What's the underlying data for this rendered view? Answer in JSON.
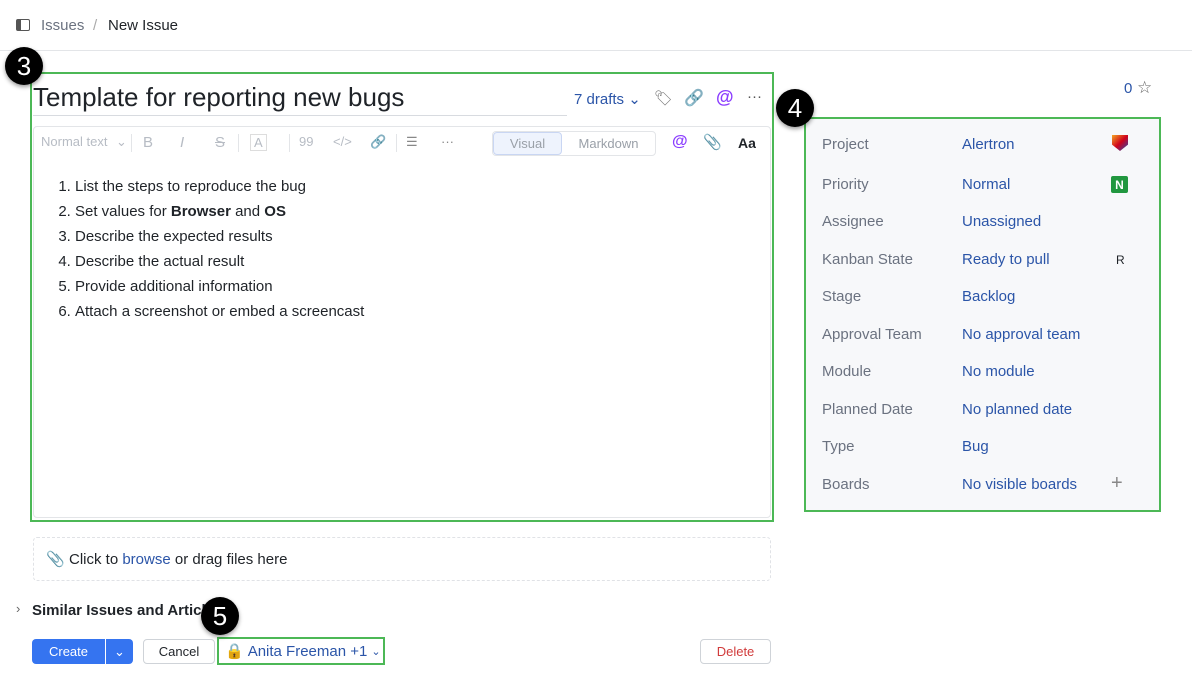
{
  "breadcrumb": {
    "root": "Issues",
    "sep": "/",
    "current": "New Issue"
  },
  "title": "Template for reporting new bugs",
  "drafts": "7 drafts",
  "toolbar": {
    "format": "Normal text",
    "bold": "B",
    "italic": "I",
    "strike": "S",
    "color": "A",
    "quote": "99",
    "code": "</>",
    "list": "☰",
    "more": "···",
    "visual": "Visual",
    "markdown": "Markdown",
    "font": "Aa"
  },
  "steps": [
    "List the steps to reproduce the bug",
    "Set values for ",
    "Describe the expected results",
    "Describe the actual result",
    "Provide additional information",
    "Attach a screenshot or embed a screencast"
  ],
  "step2": {
    "b1": "Browser",
    "mid": " and ",
    "b2": "OS"
  },
  "attach": {
    "pre": "Click to ",
    "link": "browse",
    "post": " or drag files here"
  },
  "similar": "Similar Issues and Articles",
  "buttons": {
    "create": "Create",
    "cancel": "Cancel",
    "visibility": "Anita Freeman +1",
    "delete": "Delete"
  },
  "votes": "0",
  "fields": [
    {
      "label": "Project",
      "value": "Alertron"
    },
    {
      "label": "Priority",
      "value": "Normal",
      "badge": "N"
    },
    {
      "label": "Assignee",
      "value": "Unassigned"
    },
    {
      "label": "Kanban State",
      "value": "Ready to pull",
      "badge": "R"
    },
    {
      "label": "Stage",
      "value": "Backlog"
    },
    {
      "label": "Approval Team",
      "value": "No approval team"
    },
    {
      "label": "Module",
      "value": "No module"
    },
    {
      "label": "Planned Date",
      "value": "No planned date"
    },
    {
      "label": "Type",
      "value": "Bug"
    },
    {
      "label": "Boards",
      "value": "No visible boards"
    }
  ],
  "annotations": [
    "3",
    "4",
    "5"
  ]
}
